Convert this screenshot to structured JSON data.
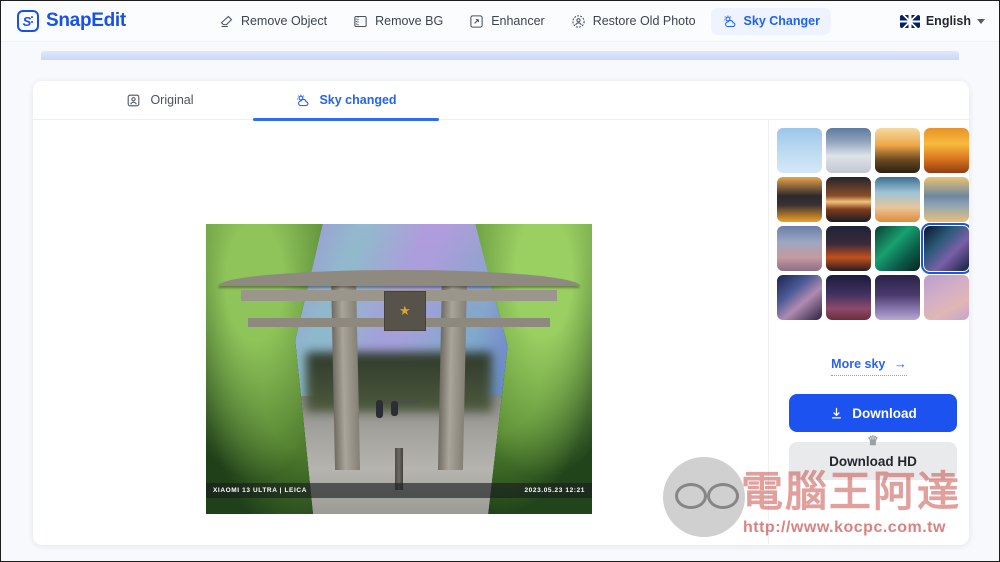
{
  "header": {
    "brand": "SnapEdit",
    "logo_letter": "S",
    "nav": [
      {
        "label": "Remove Object",
        "icon": "eraser-icon",
        "active": false
      },
      {
        "label": "Remove BG",
        "icon": "remove-background-icon",
        "active": false
      },
      {
        "label": "Enhancer",
        "icon": "enhance-icon",
        "active": false
      },
      {
        "label": "Restore Old Photo",
        "icon": "restore-photo-icon",
        "active": false
      },
      {
        "label": "Sky Changer",
        "icon": "sky-icon",
        "active": true
      }
    ],
    "language": {
      "label": "English",
      "flag": "uk-flag-icon",
      "caret": "chevron-down-icon"
    }
  },
  "tabs": [
    {
      "label": "Original",
      "icon": "portrait-icon",
      "active": false
    },
    {
      "label": "Sky changed",
      "icon": "sky-icon",
      "active": true
    }
  ],
  "photo": {
    "scene": "japanese-torii-gate-with-aurora-sky",
    "plaque_symbol": "★",
    "exif_left": "XIAOMI 13 ULTRA | LEICA",
    "exif_right": "2023.05.23  12:21"
  },
  "sky_panel": {
    "thumbnails": [
      {
        "name": "blue-sky-clouds",
        "selected": false,
        "css": "linear-gradient(to bottom,#9cc6ea 0%,#b8d8f0 45%,#d7e8f6 100%)"
      },
      {
        "name": "cumulus-clouds",
        "selected": false,
        "css": "linear-gradient(to bottom,#5d7ba0 0%,#8fa3bd 30%,#dfe3e8 62%,#c2c8d0 100%)"
      },
      {
        "name": "golden-sunrise-sea",
        "selected": false,
        "css": "linear-gradient(to bottom,#f4d9a0 0%,#f0a648 38%,#6d4a22 70%,#2a2113 100%)"
      },
      {
        "name": "orange-sunset",
        "selected": false,
        "css": "linear-gradient(to bottom,#e89327 0%,#f7bb3c 35%,#d9731d 70%,#8e3d12 100%)"
      },
      {
        "name": "dark-hills-orange-sky",
        "selected": false,
        "css": "linear-gradient(to bottom,#e8a34b 0%,#2c2a2c 42%,#3a3133 62%,#f3a126 100%)"
      },
      {
        "name": "sun-on-horizon",
        "selected": false,
        "css": "linear-gradient(to bottom,#23242c 0%,#8a4f2a 42%,#f2c277 55%,#7d3d1f 72%,#1b1c22 100%)"
      },
      {
        "name": "teal-clouds-sunset",
        "selected": false,
        "css": "linear-gradient(to bottom,#3c6f93 0%,#9fc4d6 35%,#e7c59a 68%,#e08c38 100%)"
      },
      {
        "name": "hazy-sea-horizon",
        "selected": false,
        "css": "linear-gradient(to bottom,#e9c375 0%,#6f86a0 42%,#8ea3b5 62%,#e7c079 100%)"
      },
      {
        "name": "moon-over-mountain",
        "selected": false,
        "css": "linear-gradient(to bottom,#6b7ea8 0%,#9aa7c2 35%,#c79a9e 70%,#8b6e86 100%)"
      },
      {
        "name": "blood-moon-clouds",
        "selected": false,
        "css": "linear-gradient(to bottom,#1d2336 0%,#3a2a3a 40%,#c2501d 70%,#2a1d22 100%)"
      },
      {
        "name": "green-aurora",
        "selected": false,
        "css": "linear-gradient(135deg,#0c3d34 0%,#17a06f 40%,#0b5c4a 70%,#07231f 100%)"
      },
      {
        "name": "purple-aurora",
        "selected": true,
        "css": "linear-gradient(135deg,#0b1530 0%,#2a5a78 35%,#7a5fa8 62%,#11213f 100%)"
      },
      {
        "name": "milky-way-left",
        "selected": false,
        "css": "linear-gradient(140deg,#1a2450 0%,#4b5a96 35%,#b08ab0 60%,#2a2140 100%)"
      },
      {
        "name": "milky-way-core",
        "selected": false,
        "css": "linear-gradient(to bottom,#1c1c3c 0%,#3d3060 40%,#8d4a6a 75%,#6d2d3a 100%)"
      },
      {
        "name": "violet-night-sky",
        "selected": false,
        "css": "linear-gradient(to bottom,#2a2348 0%,#4a3a6e 45%,#8f7fb4 80%,#b9a8cf 100%)"
      },
      {
        "name": "pink-rainbow-sky",
        "selected": false,
        "css": "linear-gradient(150deg,#b79fd0 0%,#d3aec6 40%,#e0b7b4 70%,#c6a4cf 100%)"
      }
    ],
    "more_sky": {
      "label": "More sky",
      "arrow": "→"
    },
    "download": {
      "label": "Download",
      "icon": "download-icon"
    },
    "download_hd": {
      "label": "Download HD",
      "icon": "crown-icon"
    }
  },
  "watermark": {
    "brand_cn": "電腦王阿達",
    "url": "http://www.kocpc.com.tw"
  },
  "colors": {
    "accent": "#1b52f0",
    "nav_active_bg": "#eef3ff",
    "page_bg": "#f7f9fc"
  }
}
